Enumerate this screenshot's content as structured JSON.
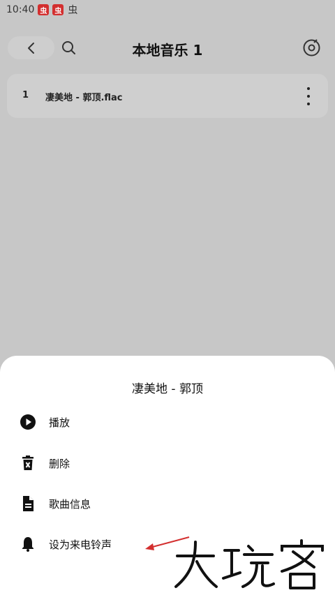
{
  "status_bar": {
    "time": "10:40",
    "badges": [
      "虫",
      "虫",
      "虫"
    ]
  },
  "header": {
    "title": "本地音乐 1"
  },
  "tracks": [
    {
      "index": "1",
      "name": "凄美地 - 郭顶.flac"
    }
  ],
  "sheet": {
    "title": "凄美地 - 郭顶",
    "items": [
      {
        "label": "播放",
        "icon": "play-icon"
      },
      {
        "label": "删除",
        "icon": "delete-icon"
      },
      {
        "label": "歌曲信息",
        "icon": "document-icon"
      },
      {
        "label": "设为来电铃声",
        "icon": "bell-icon"
      }
    ]
  },
  "watermark": {
    "text": "大玩家"
  },
  "colors": {
    "overlay_bg": "#c7c7c7",
    "sheet_bg": "#ffffff",
    "arrow": "#d32f2f"
  }
}
